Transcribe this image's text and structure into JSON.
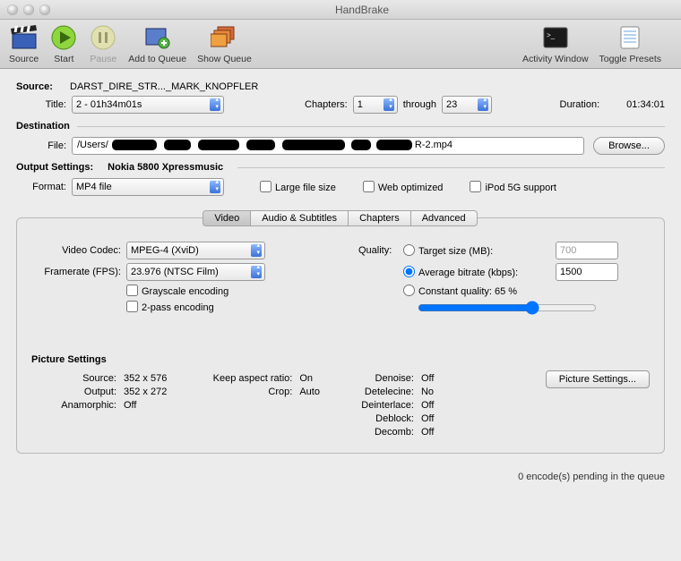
{
  "window": {
    "title": "HandBrake"
  },
  "toolbar": {
    "source": "Source",
    "start": "Start",
    "pause": "Pause",
    "add_queue": "Add to Queue",
    "show_queue": "Show Queue",
    "activity": "Activity Window",
    "presets": "Toggle Presets"
  },
  "source": {
    "label": "Source:",
    "value": "DARST_DIRE_STR..._MARK_KNOPFLER",
    "title_label": "Title:",
    "title_value": "2 - 01h34m01s",
    "chapters_label": "Chapters:",
    "chapter_from": "1",
    "through": "through",
    "chapter_to": "23",
    "duration_label": "Duration:",
    "duration_value": "01:34:01"
  },
  "dest": {
    "label": "Destination",
    "file_label": "File:",
    "file_prefix": "/Users/",
    "file_suffix": "R-2.mp4",
    "browse": "Browse..."
  },
  "output": {
    "label": "Output Settings:",
    "preset": "Nokia 5800 Xpressmusic",
    "format_label": "Format:",
    "format_value": "MP4 file",
    "large": "Large file size",
    "web": "Web optimized",
    "ipod": "iPod 5G support"
  },
  "tabs": {
    "video": "Video",
    "audio": "Audio & Subtitles",
    "chapters": "Chapters",
    "advanced": "Advanced"
  },
  "video": {
    "codec_label": "Video Codec:",
    "codec_value": "MPEG-4 (XviD)",
    "fps_label": "Framerate (FPS):",
    "fps_value": "23.976 (NTSC Film)",
    "gray": "Grayscale encoding",
    "twopass": "2-pass encoding",
    "quality_label": "Quality:",
    "target_label": "Target size (MB):",
    "target_value": "700",
    "bitrate_label": "Average bitrate (kbps):",
    "bitrate_value": "1500",
    "cq_label": "Constant quality: 65 %"
  },
  "picture": {
    "label": "Picture Settings",
    "source_l": "Source:",
    "source_v": "352 x 576",
    "output_l": "Output:",
    "output_v": "352 x 272",
    "anam_l": "Anamorphic:",
    "anam_v": "Off",
    "keep_l": "Keep aspect ratio:",
    "keep_v": "On",
    "crop_l": "Crop:",
    "crop_v": "Auto",
    "denoise_l": "Denoise:",
    "denoise_v": "Off",
    "detel_l": "Detelecine:",
    "detel_v": "No",
    "deint_l": "Deinterlace:",
    "deint_v": "Off",
    "deblock_l": "Deblock:",
    "deblock_v": "Off",
    "decomb_l": "Decomb:",
    "decomb_v": "Off",
    "btn": "Picture Settings..."
  },
  "status": "0 encode(s) pending in the queue"
}
